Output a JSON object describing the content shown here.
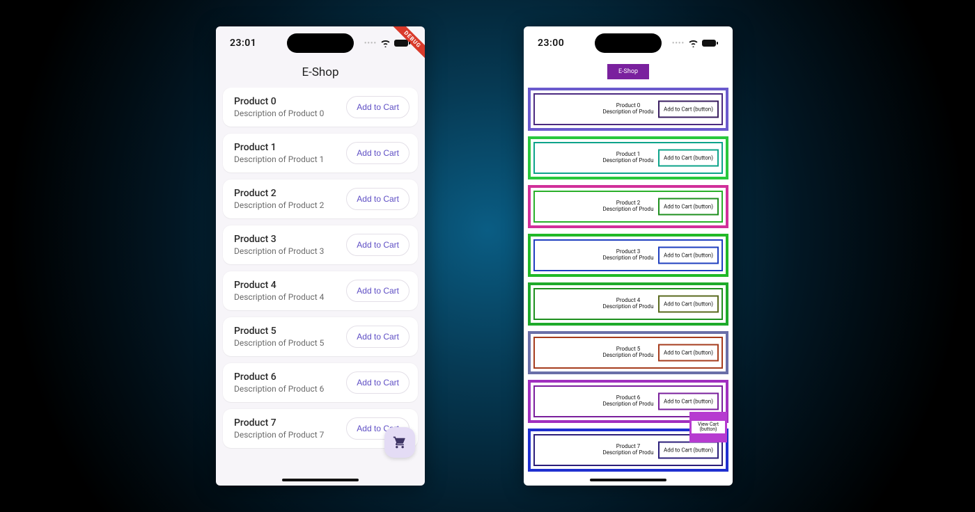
{
  "left": {
    "statusTime": "23:01",
    "appTitle": "E-Shop",
    "debugLabel": "DEBUG",
    "addLabel": "Add to Cart",
    "products": [
      {
        "title": "Product 0",
        "desc": "Description of Product 0"
      },
      {
        "title": "Product 1",
        "desc": "Description of Product 1"
      },
      {
        "title": "Product 2",
        "desc": "Description of Product 2"
      },
      {
        "title": "Product 3",
        "desc": "Description of Product 3"
      },
      {
        "title": "Product 4",
        "desc": "Description of Product 4"
      },
      {
        "title": "Product 5",
        "desc": "Description of Product 5"
      },
      {
        "title": "Product 6",
        "desc": "Description of Product 6"
      },
      {
        "title": "Product 7",
        "desc": "Description of Product 7"
      }
    ]
  },
  "right": {
    "statusTime": "23:00",
    "appTitle": "E-Shop",
    "btnLabel": "Add to Cart (button)",
    "fabLabel": "View Cart (button)",
    "rows": [
      {
        "title": "Product 0",
        "desc": "Description of Produ",
        "outer": "o-blueviolet",
        "inner": "i-blueviolet",
        "btn": "b-dpurple"
      },
      {
        "title": "Product 1",
        "desc": "Description of Produ",
        "outer": "o-green",
        "inner": "i-teal",
        "btn": "b-teal"
      },
      {
        "title": "Product 2",
        "desc": "Description of Produ",
        "outer": "o-magenta",
        "inner": "i-green",
        "btn": "b-green"
      },
      {
        "title": "Product 3",
        "desc": "Description of Produ",
        "outer": "o-green2",
        "inner": "i-blue",
        "btn": "b-blue"
      },
      {
        "title": "Product 4",
        "desc": "Description of Produ",
        "outer": "o-green3",
        "inner": "i-green3",
        "btn": "b-olive"
      },
      {
        "title": "Product 5",
        "desc": "Description of Produ",
        "outer": "o-slate",
        "inner": "i-brown",
        "btn": "b-brown"
      },
      {
        "title": "Product 6",
        "desc": "Description of Produ",
        "outer": "o-purple",
        "inner": "i-purple",
        "btn": "b-purple"
      },
      {
        "title": "Product 7",
        "desc": "Description of Produ",
        "outer": "o-royal",
        "inner": "i-indigo",
        "btn": "b-indigo"
      }
    ]
  }
}
